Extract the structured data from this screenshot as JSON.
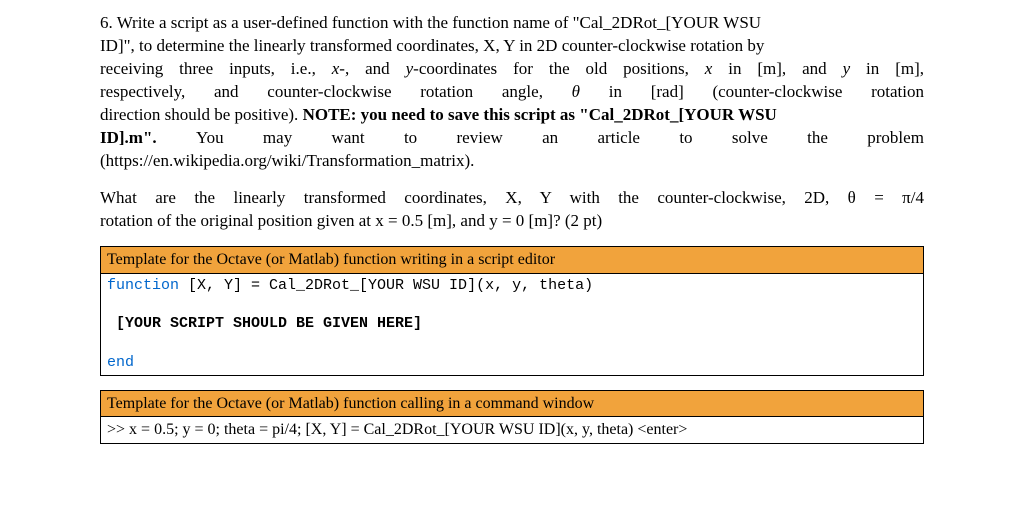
{
  "problem": {
    "line1_prefix": "6. Write a script as a user-defined function with the function name of \"Cal_2DRot_[YOUR WSU",
    "line2": "ID]\", to determine the linearly transformed coordinates, X, Y in 2D counter-clockwise rotation by",
    "line3_a": "receiving three inputs, i.e., ",
    "line3_b": "x",
    "line3_c": "-, and ",
    "line3_d": "y",
    "line3_e": "-coordinates for the old positions, ",
    "line3_f": "x",
    "line3_g": " in [m], and ",
    "line3_h": "y",
    "line3_i": " in [m],",
    "line4_a": "respectively, and counter-clockwise rotation angle, ",
    "line4_b": "θ",
    "line4_c": " in [rad] (counter-clockwise rotation",
    "line5_a": "direction should be positive). ",
    "line5_b": "NOTE: you need to save this script as \"Cal_2DRot_[YOUR WSU",
    "line6_a": "ID].m\".",
    "line6_w1": "You",
    "line6_w2": "may",
    "line6_w3": "want",
    "line6_w4": "to",
    "line6_w5": "review",
    "line6_w6": "an",
    "line6_w7": "article",
    "line6_w8": "to",
    "line6_w9": "solve",
    "line6_w10": "the",
    "line6_w11": "problem",
    "line7": "(https://en.wikipedia.org/wiki/Transformation_matrix)."
  },
  "question": {
    "line1_a": "What are the linearly transformed coordinates, X, Y with the counter-clockwise, 2D, ",
    "line1_b": "θ",
    "line1_c": " = π/4",
    "line2_a": "rotation of the original position given at ",
    "line2_b": "x",
    "line2_c": " = 0.5 [m], and ",
    "line2_d": "y",
    "line2_e": " = 0 [m]? (2 pt)"
  },
  "template1": {
    "header": "Template for the Octave (or Matlab) function writing in a script editor",
    "code1_kw": "function",
    "code1_rest": " [X, Y] = Cal_2DRot_[YOUR WSU ID](x, y, theta)",
    "code2": " [YOUR SCRIPT SHOULD BE GIVEN HERE]",
    "code3_kw": "end"
  },
  "template2": {
    "header": "Template for the Octave (or Matlab) function calling in a command window",
    "call": ">> x = 0.5; y = 0; theta = pi/4; [X, Y] = Cal_2DRot_[YOUR WSU ID](x, y, theta) <enter>"
  }
}
